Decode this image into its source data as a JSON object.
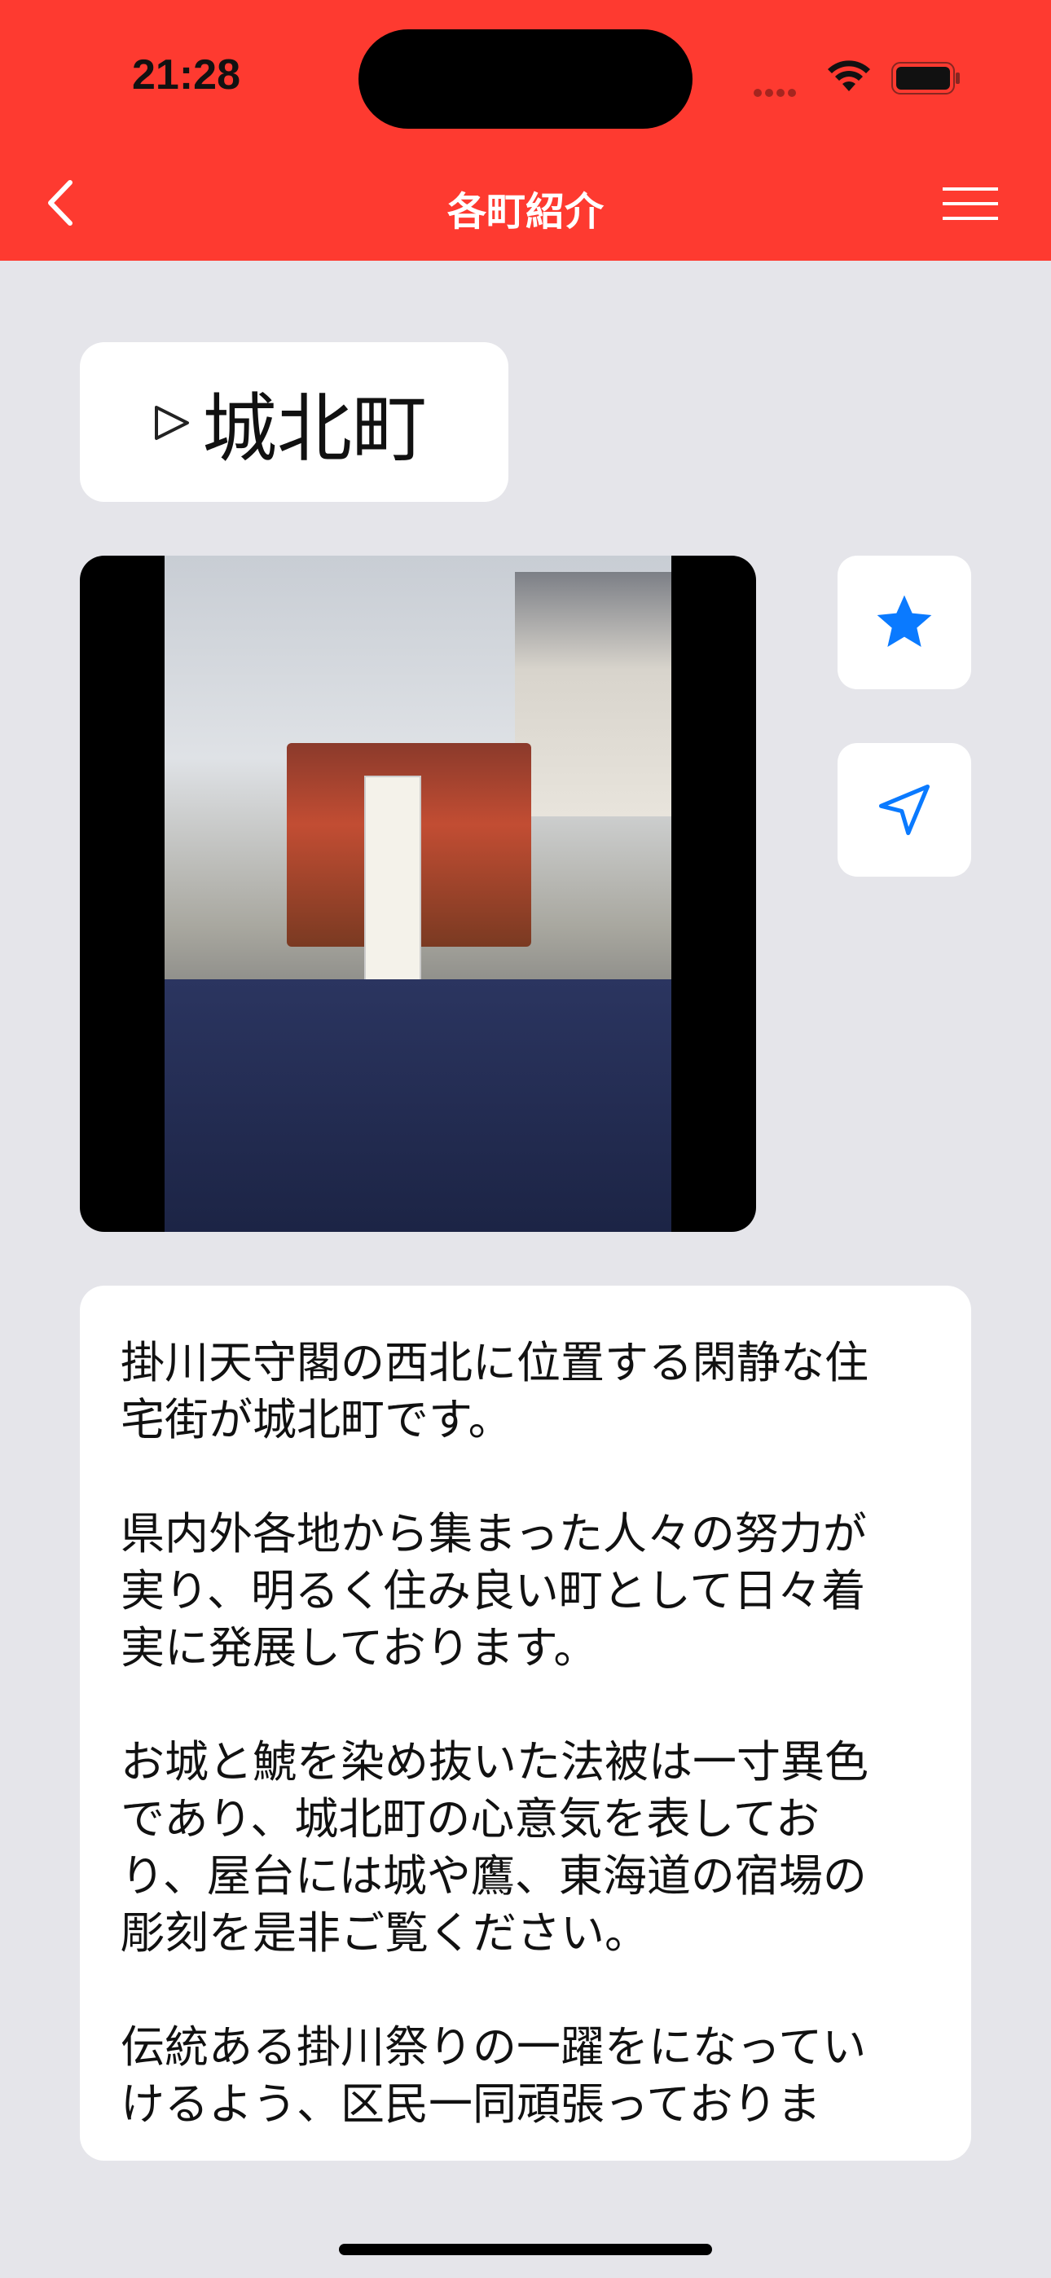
{
  "status_bar": {
    "time": "21:28"
  },
  "nav": {
    "title": "各町紹介"
  },
  "town": {
    "name": "城北町"
  },
  "description": "掛川天守閣の西北に位置する閑静な住\n宅街が城北町です。\n\n県内外各地から集まった人々の努力が\n実り、明るく住み良い町として日々着\n実に発展しております。\n\nお城と鯱を染め抜いた法被は一寸異色\nであり、城北町の心意気を表してお\nり、屋台には城や鷹、東海道の宿場の\n彫刻を是非ご覧ください。\n\n伝統ある掛川祭りの一躍をになってい\nけるよう、区民一同頑張っておりま",
  "colors": {
    "accent": "#fe3a30",
    "icon_blue": "#0a7aff",
    "background": "#e5e5ea"
  },
  "icons": {
    "favorite": "star-icon",
    "navigate": "location-arrow-icon",
    "back": "chevron-left-icon",
    "menu": "hamburger-icon"
  }
}
